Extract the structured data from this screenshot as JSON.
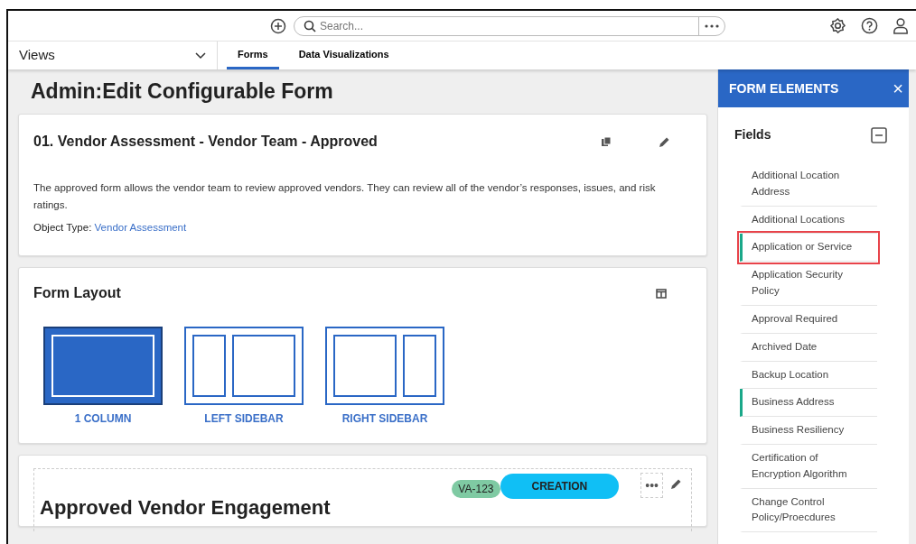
{
  "top_bar": {
    "search": {
      "placeholder": "Search..."
    }
  },
  "views": {
    "label": "Views"
  },
  "tabs": [
    {
      "label": "Forms",
      "selected": true
    },
    {
      "label": "Data Visualizations",
      "selected": false
    }
  ],
  "page_title": {
    "prefix": "Admin",
    "sep": ":",
    "title": "Edit Configurable Form"
  },
  "form_card": {
    "title": "01. Vendor Assessment - Vendor Team - Approved",
    "description": "The approved form allows the vendor team to review approved vendors. They can review all of the vendor’s responses, issues, and risk ratings.",
    "object_type_label": "Object Type:",
    "object_type": "Vendor Assessment"
  },
  "layout_card": {
    "title": "Form Layout",
    "options": [
      {
        "kind": "one",
        "label": "1 COLUMN",
        "selected": true
      },
      {
        "kind": "left",
        "label": "LEFT SIDEBAR",
        "selected": false
      },
      {
        "kind": "right",
        "label": "RIGHT SIDEBAR",
        "selected": false
      }
    ]
  },
  "section": {
    "title": "Approved Vendor Engagement",
    "id_badge": "VA-123",
    "status": "CREATION",
    "more": "•••"
  },
  "panel": {
    "title": "FORM ELEMENTS",
    "close": "×",
    "group": "Fields",
    "items": [
      {
        "label": "Additional Location Address",
        "marked": false,
        "highlighted": false
      },
      {
        "label": "Additional Locations",
        "marked": false,
        "highlighted": false
      },
      {
        "label": "Application or Service",
        "marked": true,
        "highlighted": true
      },
      {
        "label": "Application Security Policy",
        "marked": false,
        "highlighted": false
      },
      {
        "label": "Approval Required",
        "marked": false,
        "highlighted": false
      },
      {
        "label": "Archived Date",
        "marked": false,
        "highlighted": false
      },
      {
        "label": "Backup Location",
        "marked": false,
        "highlighted": false
      },
      {
        "label": "Business Address",
        "marked": true,
        "highlighted": false
      },
      {
        "label": "Business Resiliency",
        "marked": false,
        "highlighted": false
      },
      {
        "label": "Certification of Encryption Algorithm",
        "marked": false,
        "highlighted": false
      },
      {
        "label": "Change Control Policy/Proecdures",
        "marked": false,
        "highlighted": false
      }
    ]
  }
}
